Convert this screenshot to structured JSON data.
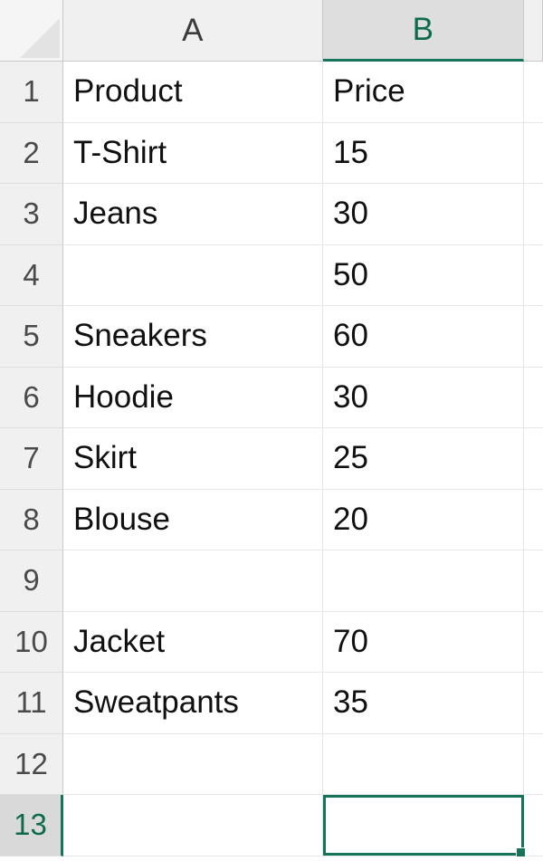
{
  "app": {
    "type": "spreadsheet",
    "selected_cell": "B13",
    "active_column": "B",
    "active_row": "13"
  },
  "colors": {
    "accent_green": "#15735a",
    "header_bg": "#f0f0f0",
    "header_active_bg": "#dedede",
    "grid_line": "#e4e4e4",
    "cell_text": "#101010"
  },
  "columns": [
    {
      "id": "A",
      "label": "A",
      "active": false
    },
    {
      "id": "B",
      "label": "B",
      "active": true
    },
    {
      "id": "C",
      "label": "",
      "active": false
    }
  ],
  "rows": [
    {
      "num": "1",
      "active": false,
      "a": "Product",
      "b": "Price"
    },
    {
      "num": "2",
      "active": false,
      "a": "T-Shirt",
      "b": "15"
    },
    {
      "num": "3",
      "active": false,
      "a": "Jeans",
      "b": "30"
    },
    {
      "num": "4",
      "active": false,
      "a": "",
      "b": "50"
    },
    {
      "num": "5",
      "active": false,
      "a": "Sneakers",
      "b": "60"
    },
    {
      "num": "6",
      "active": false,
      "a": "Hoodie",
      "b": "30"
    },
    {
      "num": "7",
      "active": false,
      "a": "Skirt",
      "b": "25"
    },
    {
      "num": "8",
      "active": false,
      "a": "Blouse",
      "b": "20"
    },
    {
      "num": "9",
      "active": false,
      "a": "",
      "b": ""
    },
    {
      "num": "10",
      "active": false,
      "a": "Jacket",
      "b": "70"
    },
    {
      "num": "11",
      "active": false,
      "a": "Sweatpants",
      "b": "35"
    },
    {
      "num": "12",
      "active": false,
      "a": "",
      "b": ""
    },
    {
      "num": "13",
      "active": true,
      "a": "",
      "b": ""
    }
  ],
  "icons": {
    "select_all": "select-all-triangle-icon",
    "fill_handle": "fill-handle-icon"
  }
}
